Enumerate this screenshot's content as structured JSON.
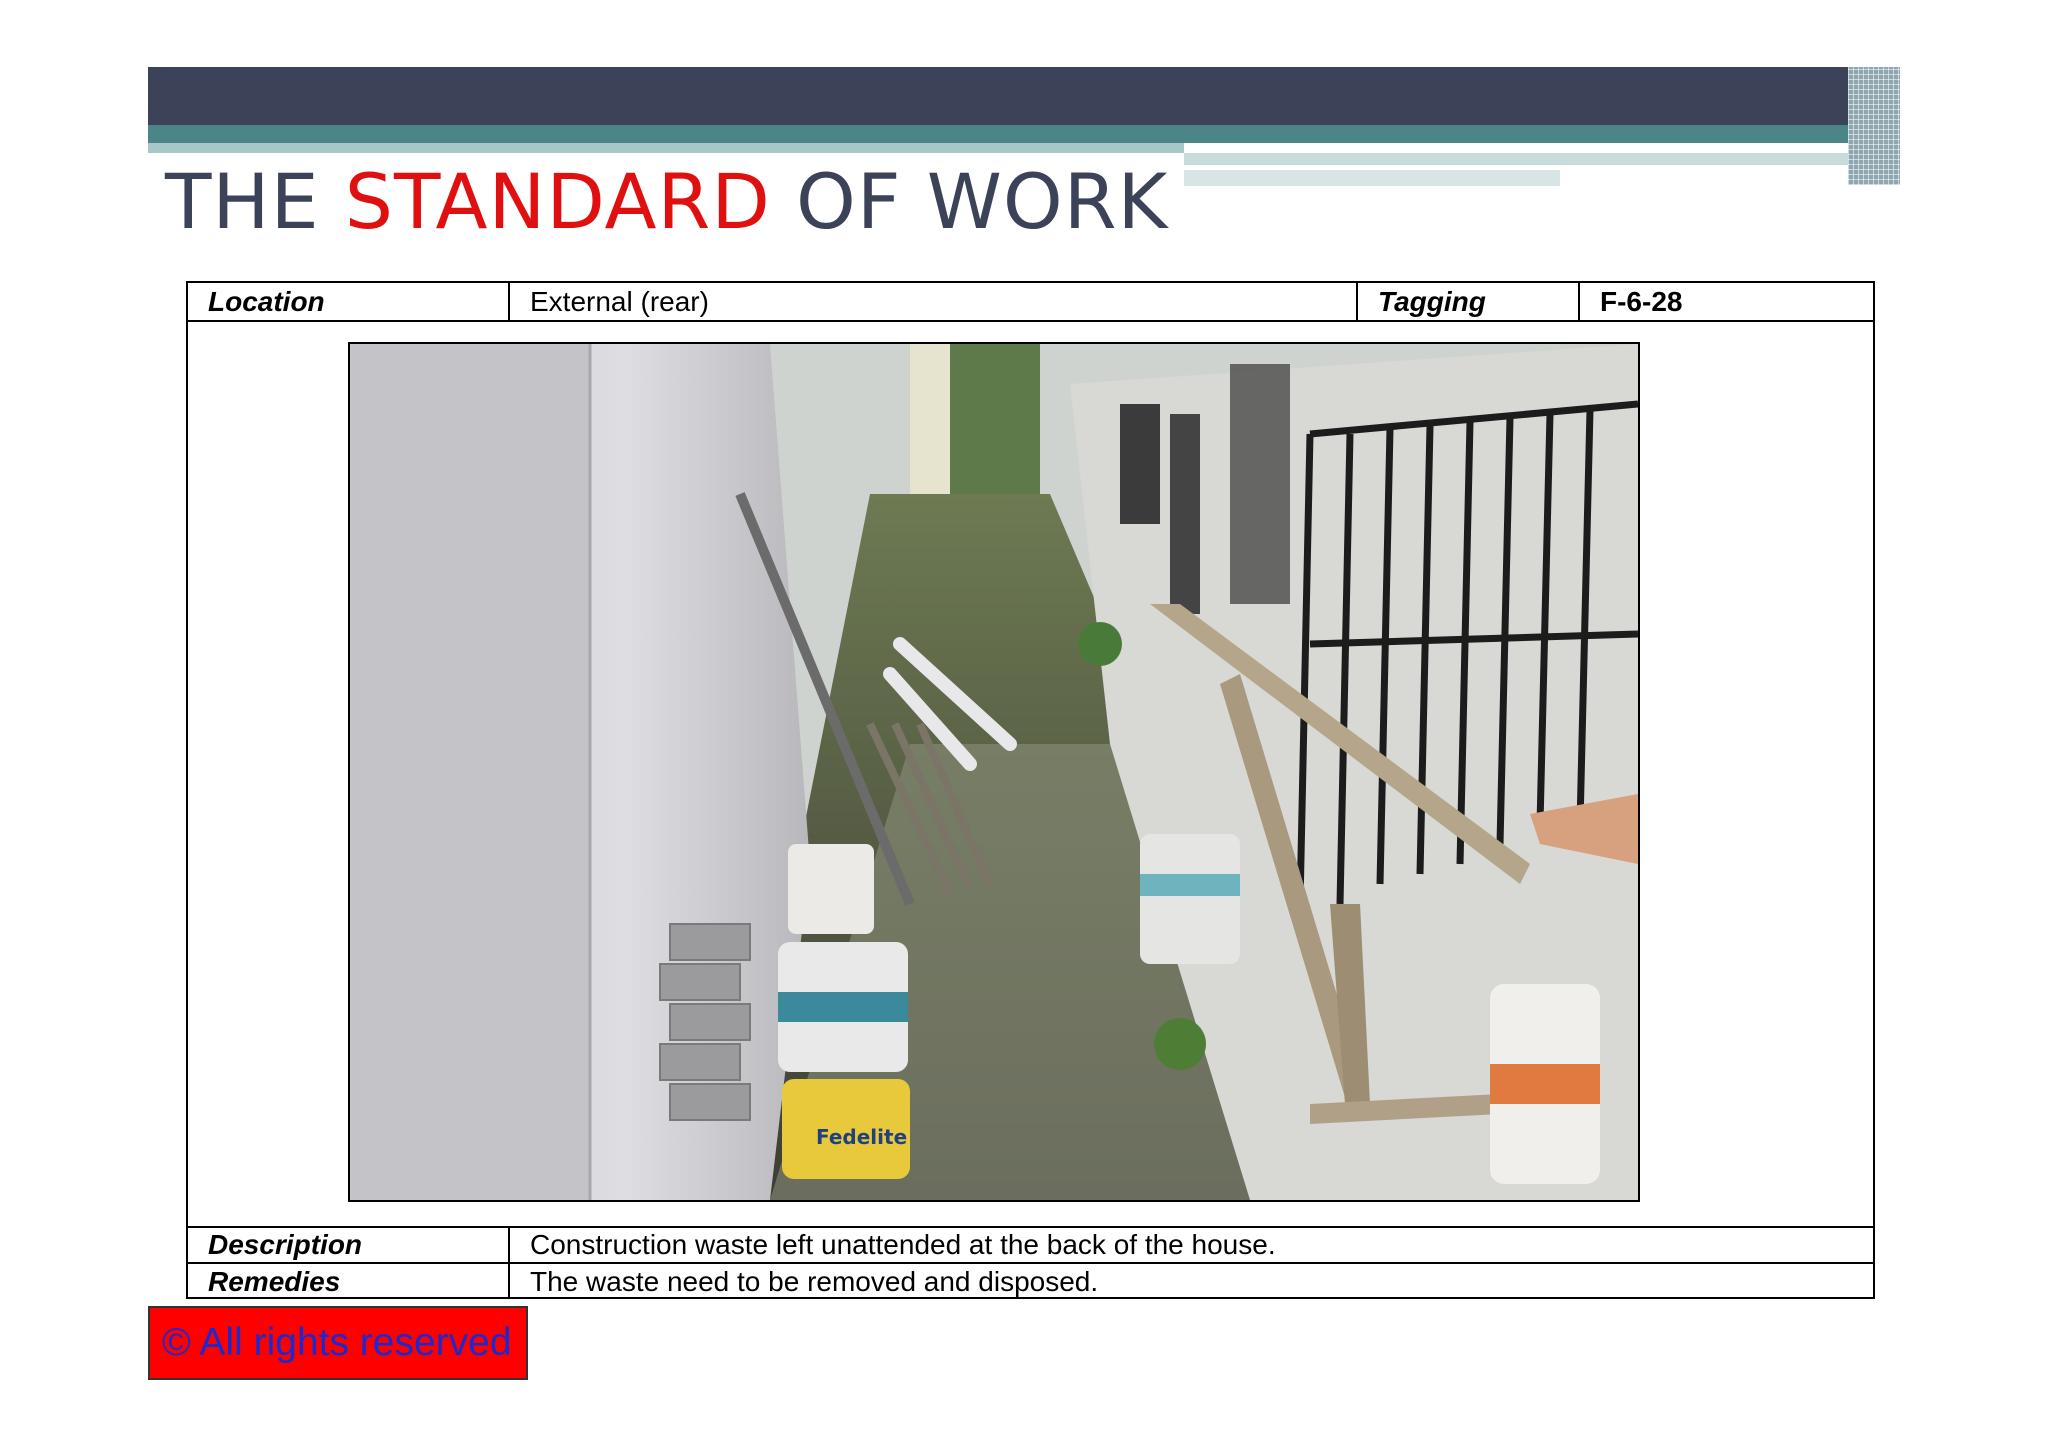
{
  "slide": {
    "title_part1": "THE ",
    "title_accent": "STANDARD",
    "title_part2": " OF WORK",
    "accent_color": "#e01010",
    "header_color": "#3c4257",
    "teal_color": "#4b8587"
  },
  "inspection": {
    "location_label": "Location",
    "location_value": "External (rear)",
    "tagging_label": "Tagging",
    "tagging_value": "F-6-28",
    "description_label": "Description",
    "description_value": "Construction waste left unattended at the back of the house.",
    "remedies_label": "Remedies",
    "remedies_value": "The waste need to be removed and disposed."
  },
  "photo": {
    "subject": "construction waste in rear alley",
    "bucket_text_1": "Fedelite"
  },
  "footer": {
    "copyright": "© All rights reserved"
  }
}
